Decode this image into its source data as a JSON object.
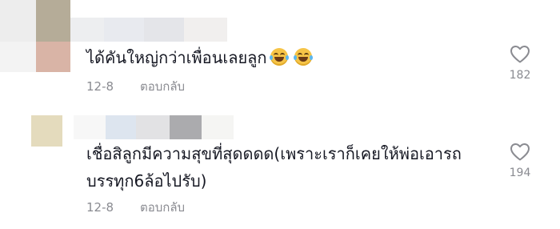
{
  "comments": [
    {
      "text": "ได้คันใหญ่กว่าเพื่อนเลยลูก",
      "emojis": [
        "grinning-squinting-tears-emoji",
        "grinning-squinting-tears-emoji"
      ],
      "date": "12-8",
      "reply_label": "ตอบกลับ",
      "likes": "182",
      "like_icon": "heart-outline-icon"
    },
    {
      "text_line1": "เชื่อสิลูกมีความสุขที่สุดดดด(เพราะเราก็เคยให้พ่อเอารถ",
      "text_line2": "บรรทุก6ล้อไปรับ)",
      "date": "12-8",
      "reply_label": "ตอบกลับ",
      "likes": "194",
      "like_icon": "heart-outline-icon"
    }
  ],
  "colors": {
    "text": "#161823",
    "meta": "#8a8b91",
    "icon": "#8a8b91"
  }
}
